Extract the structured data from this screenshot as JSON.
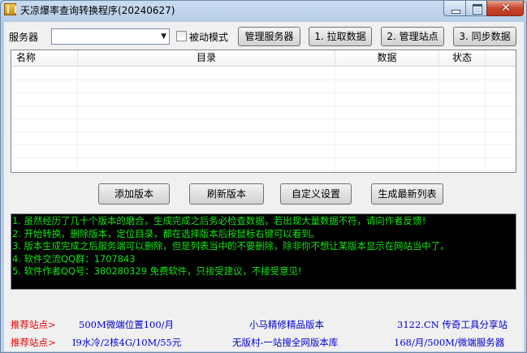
{
  "window": {
    "title": "天凉爆率查询转换程序(20240627)",
    "close_glyph": "✕"
  },
  "toolbar": {
    "server_label": "服务器",
    "server_value": "",
    "passive_label": "被动模式",
    "passive_checked": false,
    "manage_server_btn": "管理服务器",
    "fetch_btn": "1. 拉取数据",
    "manage_site_btn": "2. 管理站点",
    "sync_btn": "3. 同步数据"
  },
  "grid": {
    "columns": [
      "名称",
      "目录",
      "数据",
      "状态"
    ],
    "rows": []
  },
  "actions": {
    "add_version": "添加版本",
    "refresh_version": "刷新版本",
    "custom_settings": "自定义设置",
    "generate_list": "生成最新列表"
  },
  "console": {
    "color": "#12e612",
    "lines": [
      "1. 虽然经历了几十个版本的磨合，生成完成之后务必检查数据，若出现大量数据不符，请向作者反馈！",
      "2. 开始转换，删除版本，定位目录，都在选择版本后按鼠标右键可以看到。",
      "3. 版本生成完成之后服务端可以删除，但是列表当中的不要删除，除非你不想让某版本显示在网站当中了。",
      "4. 软件交流QQ群：1707843",
      "5. 软件作者QQ号：380280329 免费软件，只接受建议，不接受意见!"
    ]
  },
  "ads": {
    "row1": {
      "label": "推荐站点>",
      "item1": "500M微端位置100/月",
      "item2": "小马精修精品版本",
      "item3": "3122.CN 传奇工具分享站"
    },
    "row2": {
      "label": "推荐站点>",
      "item1": "I9水冷/2核4G/10M/55元",
      "item2": "无版村-一站搜全网版本库",
      "item3": "168/月/500M/微端服务器"
    }
  },
  "colors": {
    "ad_label": "#e00000",
    "ad_link": "#0000d0",
    "console_bg": "#000000"
  }
}
